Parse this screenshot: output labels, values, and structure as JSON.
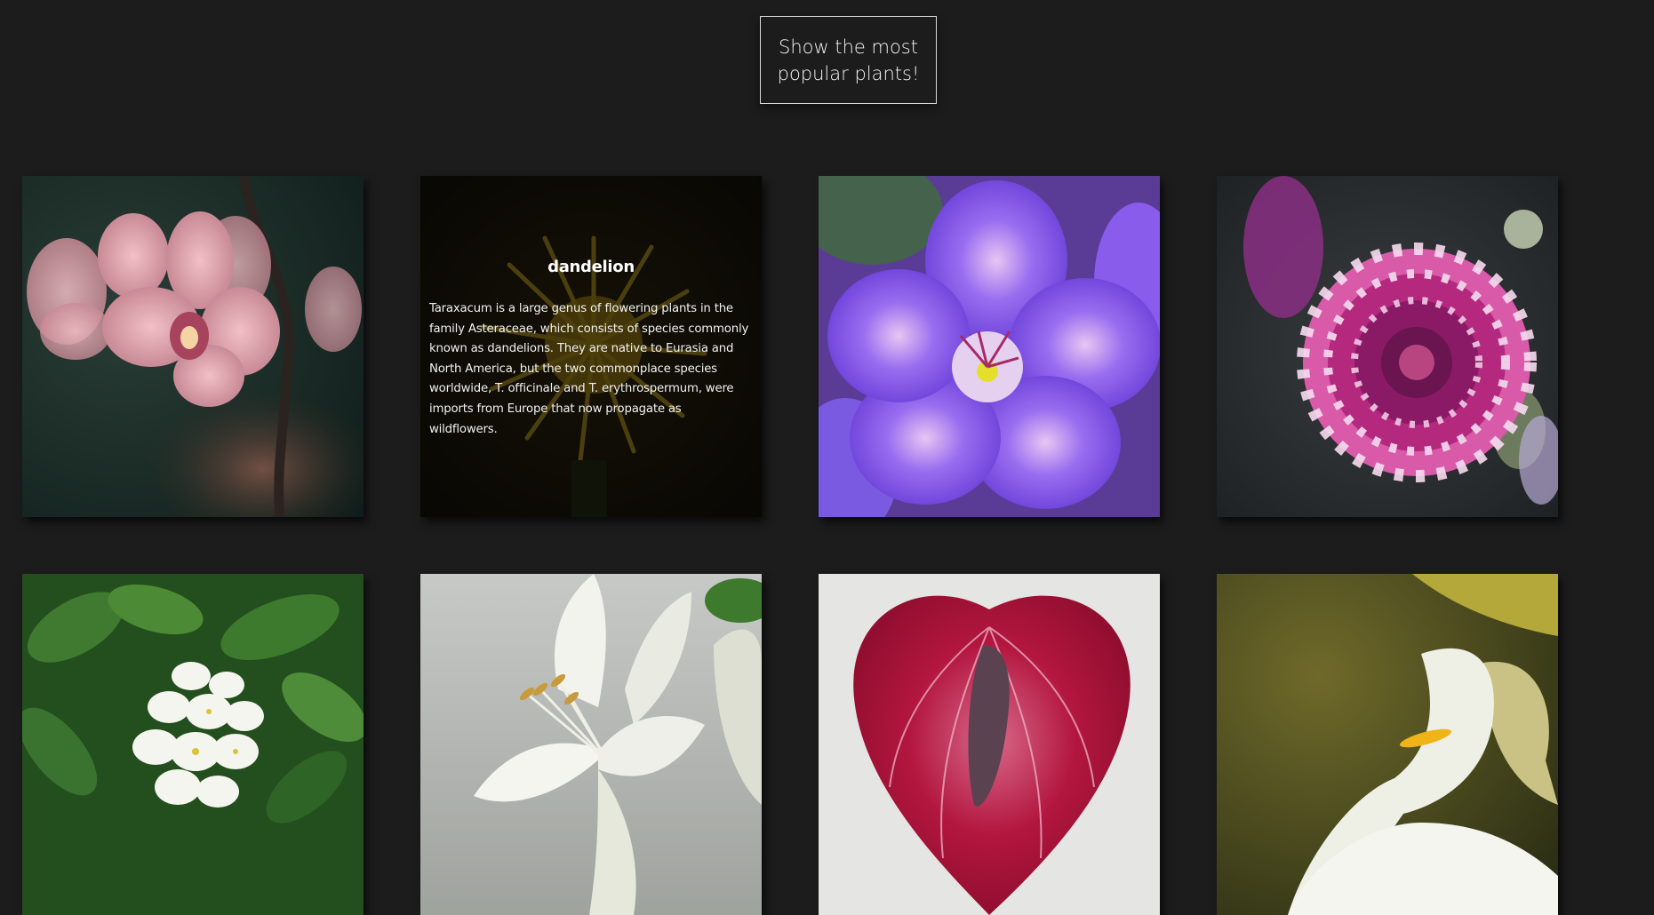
{
  "top_button": {
    "label": "Show the most popular plants!"
  },
  "gallery": {
    "cards": [
      {
        "image": "pink orchid photo"
      },
      {
        "image": "dandelion photo",
        "title": "dandelion",
        "description": "Taraxacum is a large genus of flowering plants in the family Asteraceae, which consists of species commonly known as dandelions. They are native to Eurasia and North America, but the two commonplace species worldwide, T. officinale and T. erythrospermum, were imports from Europe that now propagate as wildflowers."
      },
      {
        "image": "purple geranium photo"
      },
      {
        "image": "purple dahlia photo"
      },
      {
        "image": "white jasmine photo"
      },
      {
        "image": "white lily photo"
      },
      {
        "image": "red anthurium photo"
      },
      {
        "image": "white calla lily photo"
      }
    ]
  },
  "colors": {
    "background": "#1c1c1c",
    "button_border": "#d8d8d8",
    "text": "#f2f2f2"
  }
}
